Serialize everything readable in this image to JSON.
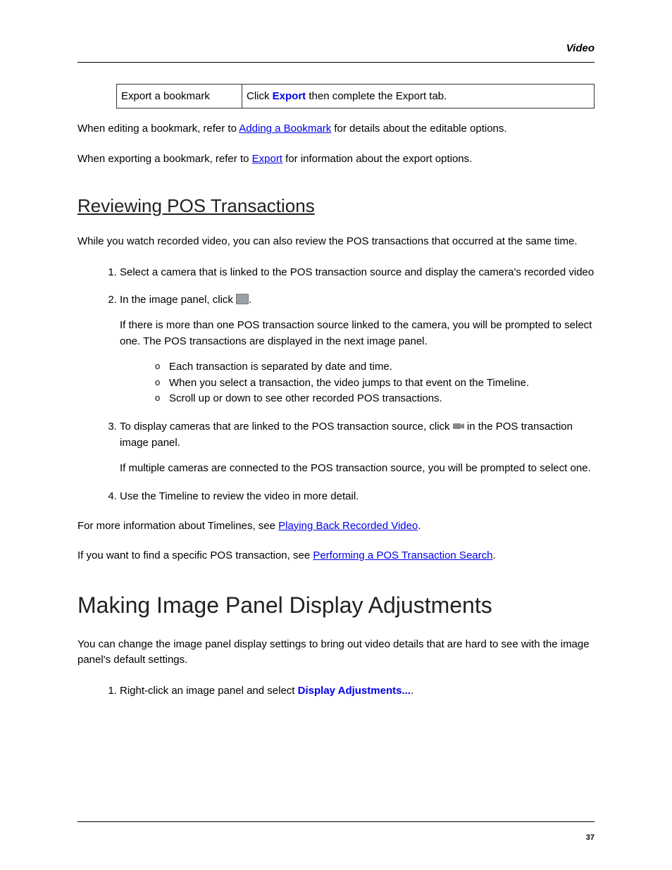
{
  "header": {
    "label": "Video"
  },
  "table": {
    "left": "Export a bookmark",
    "right_prefix": "Click ",
    "right_bold": "Export",
    "right_suffix": " then complete the Export tab."
  },
  "para1": {
    "prefix": "When editing a bookmark, refer to ",
    "link": "Adding a Bookmark",
    "suffix": " for details about the editable options."
  },
  "para2": {
    "prefix": "When exporting a bookmark, refer to ",
    "link": "Export",
    "suffix": " for information about the export options."
  },
  "section1": {
    "title": "Reviewing POS Transactions",
    "intro": "While you watch recorded video, you can also review the POS transactions that occurred at the same time.",
    "steps": {
      "s1": "Select a camera that is linked to the POS transaction source and display the camera's recorded video",
      "s2_prefix": "In the image panel, click ",
      "s2_suffix": ".",
      "s2_p": "If there is more than one POS transaction source linked to the camera, you will be prompted to select one. The POS transactions are displayed in the next image panel.",
      "s2_bullets": {
        "b1": "Each transaction is separated by date and time.",
        "b2": "When you select a transaction, the video jumps to that event on the Timeline.",
        "b3": "Scroll up or down to see other recorded POS transactions."
      },
      "s3_prefix": "To display cameras that are linked to the POS transaction source, click ",
      "s3_suffix": " in the POS transaction image panel.",
      "s3_p": "If multiple cameras are connected to the POS transaction source, you will be prompted to select one.",
      "s4": "Use the Timeline to review the video in more detail."
    },
    "outro1": {
      "prefix": "For more information about Timelines, see ",
      "link": "Playing Back Recorded Video",
      "suffix": "."
    },
    "outro2": {
      "prefix": "If you want to find a specific POS transaction, see ",
      "link": "Performing a POS Transaction Search",
      "suffix": "."
    }
  },
  "section2": {
    "title": "Making Image Panel Display Adjustments",
    "intro": "You can change the image panel display settings to bring out video details that are hard to see with the image panel's default settings.",
    "step1_prefix": "Right-click an image panel and select ",
    "step1_bold": "Display Adjustments...",
    "step1_suffix": "."
  },
  "page_number": "37"
}
